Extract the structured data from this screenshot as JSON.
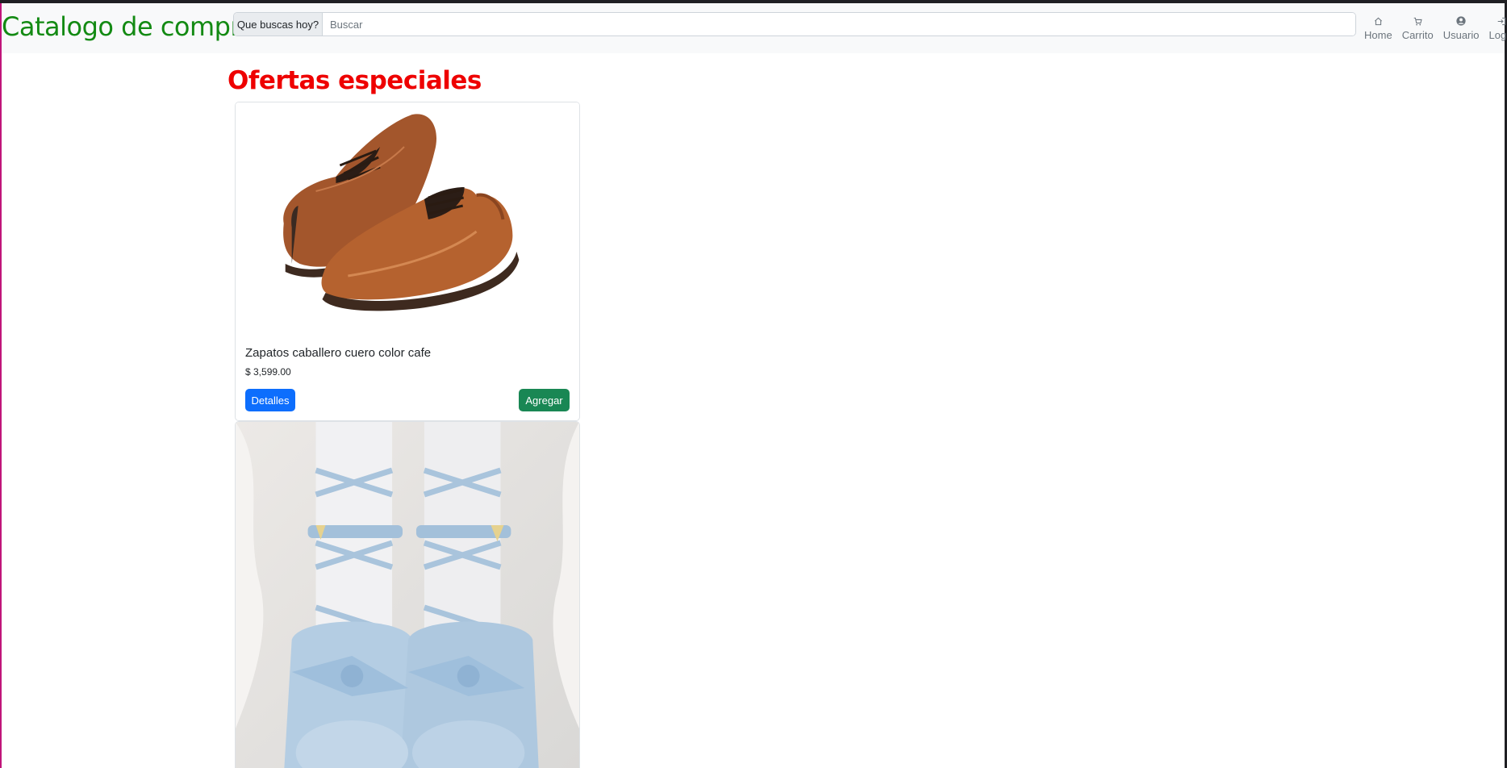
{
  "navbar": {
    "brand": "Catalogo de compra",
    "search_prefix": "Que buscas hoy?",
    "search_placeholder": "Buscar",
    "links": [
      {
        "label": "Home",
        "icon": "house-icon"
      },
      {
        "label": "Carrito",
        "icon": "cart-icon"
      },
      {
        "label": "Usuario",
        "icon": "user-circle-icon"
      },
      {
        "label": "Login",
        "icon": "login-icon"
      }
    ]
  },
  "main": {
    "title": "Ofertas especiales",
    "products": [
      {
        "name": "Zapatos caballero cuero color cafe",
        "price": "$ 3,599.00",
        "details_label": "Detalles",
        "add_label": "Agregar"
      }
    ]
  },
  "colors": {
    "brand": "#138a13",
    "title": "#ee0000",
    "details_button": "#0d6efd",
    "add_button": "#198754"
  }
}
